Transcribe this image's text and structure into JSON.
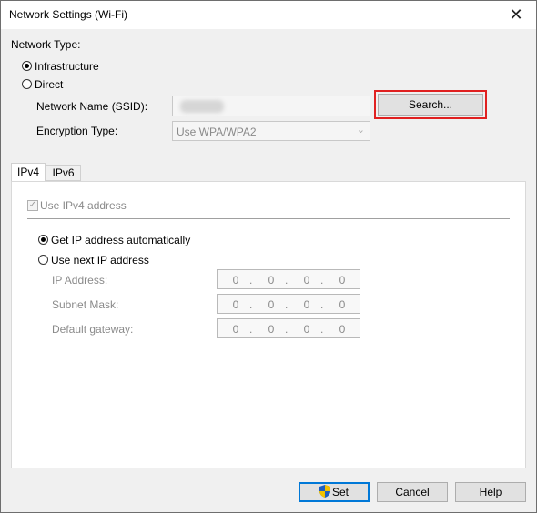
{
  "window": {
    "title": "Network Settings (Wi-Fi)"
  },
  "network_type": {
    "label": "Network Type:",
    "options": [
      {
        "label": "Infrastructure",
        "selected": true
      },
      {
        "label": "Direct",
        "selected": false
      }
    ]
  },
  "ssid": {
    "label": "Network Name (SSID):",
    "button": "Search..."
  },
  "encryption": {
    "label": "Encryption Type:",
    "value": "Use WPA/WPA2"
  },
  "tabs": [
    {
      "label": "IPv4",
      "active": true
    },
    {
      "label": "IPv6",
      "active": false
    }
  ],
  "ipv4": {
    "use_label": "Use IPv4 address",
    "auto_label": "Get IP address automatically",
    "manual_label": "Use next IP address",
    "fields": [
      {
        "label": "IP Address:",
        "octets": [
          "0",
          "0",
          "0",
          "0"
        ]
      },
      {
        "label": "Subnet Mask:",
        "octets": [
          "0",
          "0",
          "0",
          "0"
        ]
      },
      {
        "label": "Default gateway:",
        "octets": [
          "0",
          "0",
          "0",
          "0"
        ]
      }
    ]
  },
  "footer": {
    "set": "Set",
    "cancel": "Cancel",
    "help": "Help"
  },
  "colors": {
    "highlight": "#e02020",
    "accent": "#0078d7"
  }
}
